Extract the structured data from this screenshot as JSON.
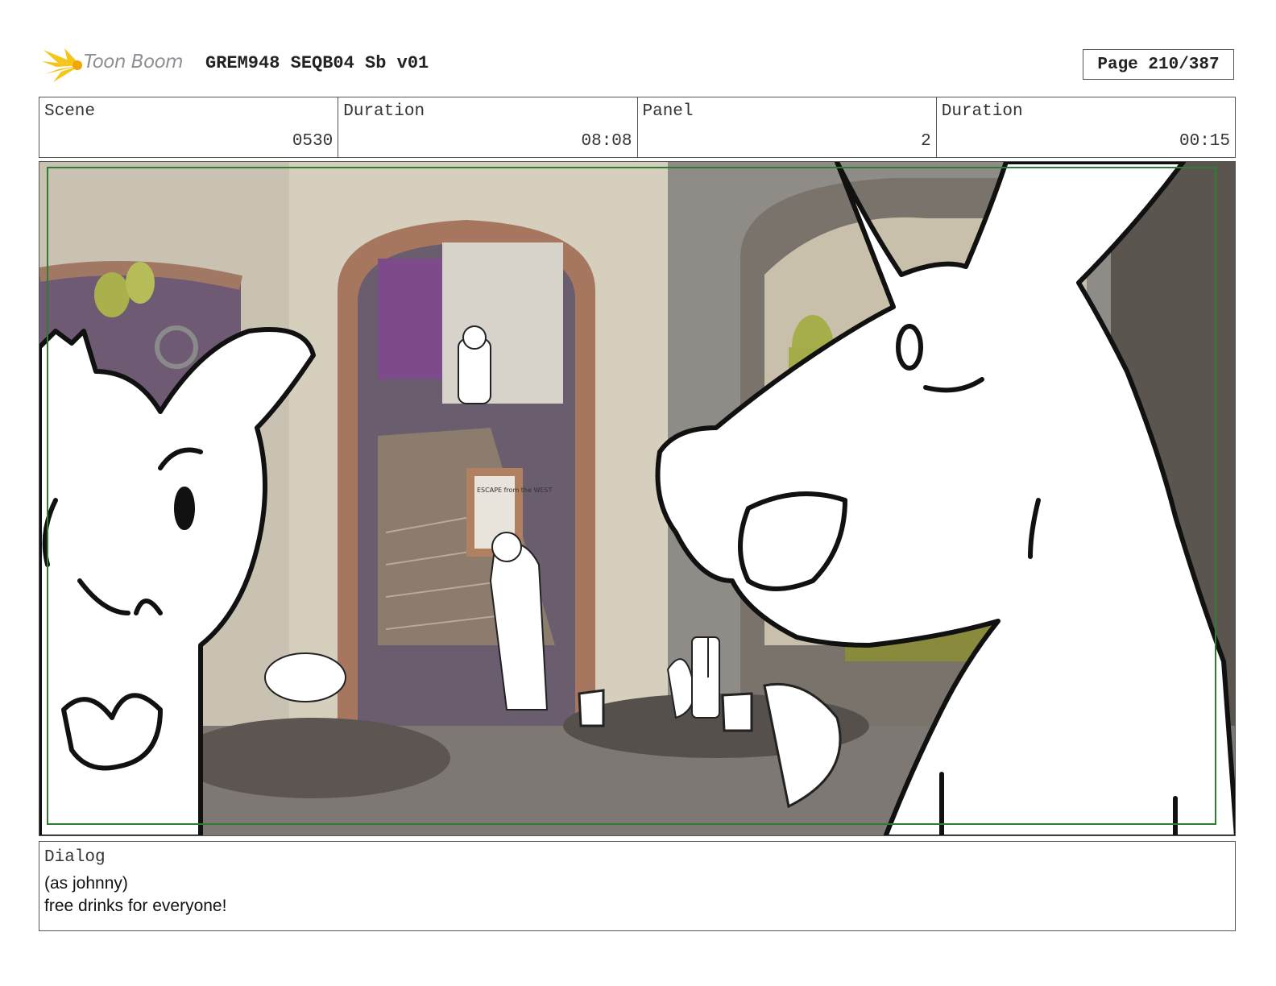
{
  "header": {
    "logo_text": "Toon Boom",
    "title": "GREM948 SEQB04 Sb v01",
    "page": "Page 210/387"
  },
  "info": {
    "scene_label": "Scene",
    "scene_value": "0530",
    "duration_label": "Duration",
    "duration_value": "08:08",
    "panel_label": "Panel",
    "panel_value": "2",
    "panel_duration_label": "Duration",
    "panel_duration_value": "00:15"
  },
  "frame": {
    "poster_text": "ESCAPE from the WEST",
    "safe_area_color": "#2e7d32"
  },
  "dialog": {
    "label": "Dialog",
    "line1": "(as johnny)",
    "line2": "free drinks for everyone!"
  },
  "colors": {
    "logo_accent": "#f5c518",
    "border": "#555555"
  }
}
